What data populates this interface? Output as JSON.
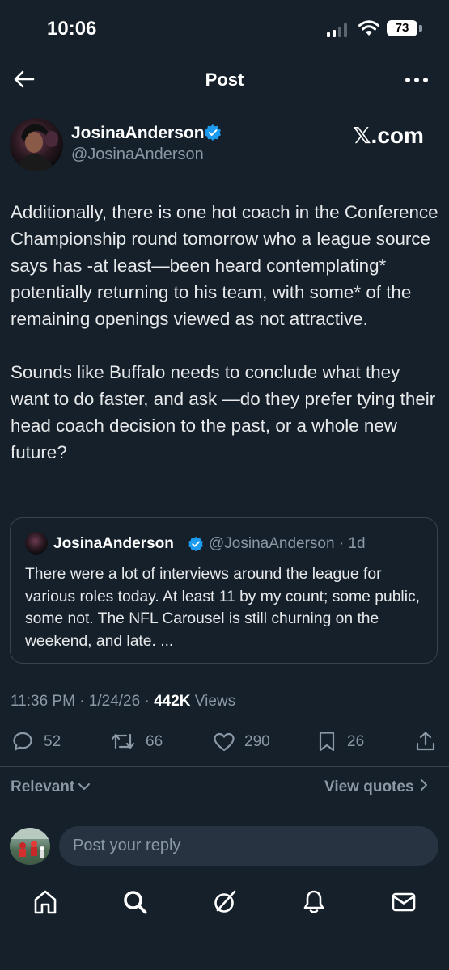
{
  "status_bar": {
    "time": "10:06",
    "battery": "73"
  },
  "header": {
    "title": "Post"
  },
  "post": {
    "author_name": "JosinaAnderson",
    "author_handle": "@JosinaAnderson",
    "watermark": "𝕏.com",
    "paragraphs": [
      "Additionally, there is one hot coach in the Conference Championship round tomorrow who a league source says has -at least—been heard contemplating* potentially returning to his team, with some* of the remaining openings viewed as not attractive.",
      "Sounds like Buffalo needs to conclude what they want to do faster, and ask —do they prefer tying their head coach decision to the past, or a whole new future?"
    ],
    "quote": {
      "author_name": "JosinaAnderson",
      "author_handle_age": "@JosinaAnderson · 1d",
      "text": "There were a lot of interviews around the league for various roles today. At least 11 by my count; some public, some not. The NFL Carousel is still churning on the weekend, and late. ..."
    },
    "timestamp": "11:36 PM · 1/24/26 · ",
    "views_count": "442K",
    "views_label": " Views",
    "actions": {
      "replies": "52",
      "reposts": "66",
      "likes": "290",
      "bookmarks": "26"
    }
  },
  "sort": {
    "relevant_label": "Relevant",
    "view_quotes_label": "View quotes"
  },
  "reply": {
    "placeholder": "Post your reply"
  },
  "colors": {
    "background": "#15202b",
    "accent": "#1d9bf0",
    "muted": "#8b98a5"
  }
}
